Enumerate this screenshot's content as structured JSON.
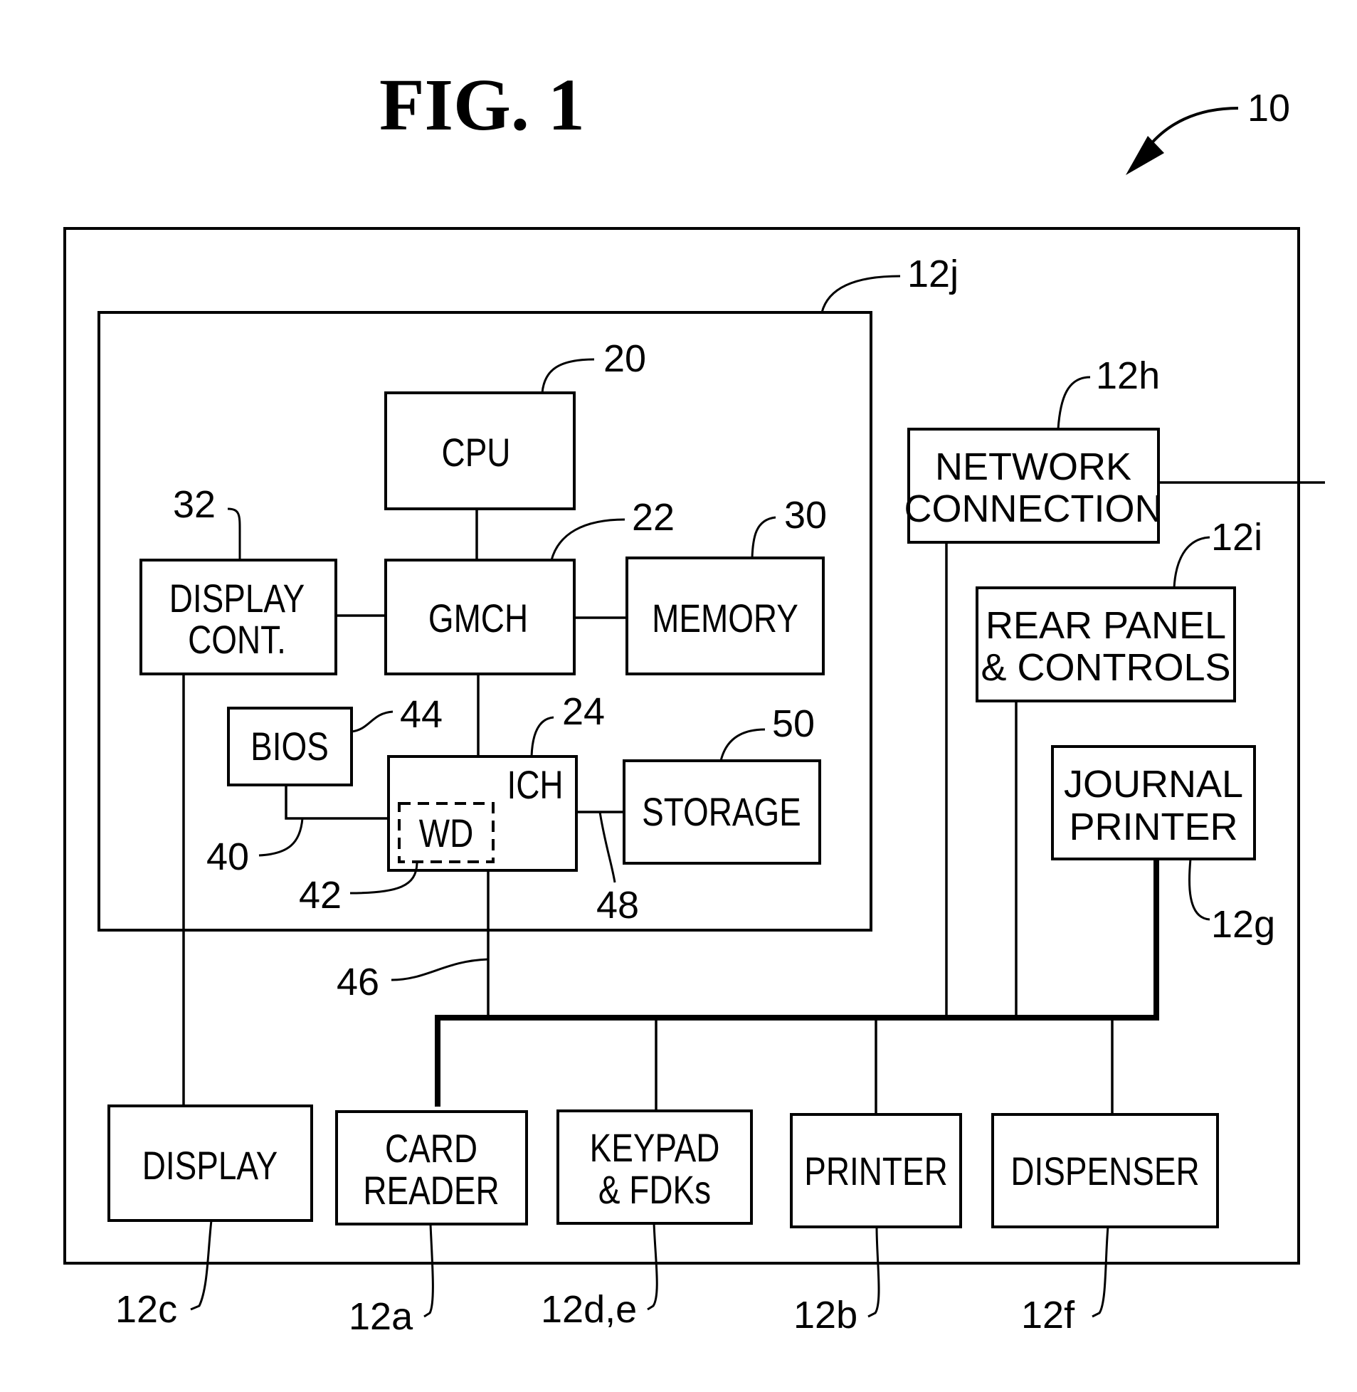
{
  "figure": {
    "title": "FIG. 1",
    "ref_system": "10"
  },
  "blocks": {
    "cpu": {
      "label": [
        "CPU"
      ],
      "ref": "20"
    },
    "gmch": {
      "label": [
        "GMCH"
      ],
      "ref": "22"
    },
    "ich": {
      "label": [
        "ICH"
      ],
      "ref": "24"
    },
    "memory": {
      "label": [
        "MEMORY"
      ],
      "ref": "30"
    },
    "display_cont": {
      "label": [
        "DISPLAY",
        "CONT."
      ],
      "ref": "32"
    },
    "bios": {
      "label": [
        "BIOS"
      ],
      "ref": "44"
    },
    "wd": {
      "label": [
        "WD"
      ],
      "ref": "42"
    },
    "storage": {
      "label": [
        "STORAGE"
      ],
      "ref": "50"
    },
    "controller": {
      "ref": "12j"
    },
    "network": {
      "label": [
        "NETWORK",
        "CONNECTION"
      ],
      "ref": "12h"
    },
    "rear_panel": {
      "label": [
        "REAR PANEL",
        "& CONTROLS"
      ],
      "ref": "12i"
    },
    "journal_printer": {
      "label": [
        "JOURNAL",
        "PRINTER"
      ],
      "ref": "12g"
    },
    "display": {
      "label": [
        "DISPLAY"
      ],
      "ref": "12c"
    },
    "card_reader": {
      "label": [
        "CARD",
        "READER"
      ],
      "ref": "12a"
    },
    "keypad": {
      "label": [
        "KEYPAD",
        "& FDKs"
      ],
      "ref": "12d,e"
    },
    "printer": {
      "label": [
        "PRINTER"
      ],
      "ref": "12b"
    },
    "dispenser": {
      "label": [
        "DISPENSER"
      ],
      "ref": "12f"
    }
  },
  "connections": {
    "bios_ich_ref": "40",
    "ich_bus_ref": "46",
    "ich_storage_ref": "48"
  }
}
